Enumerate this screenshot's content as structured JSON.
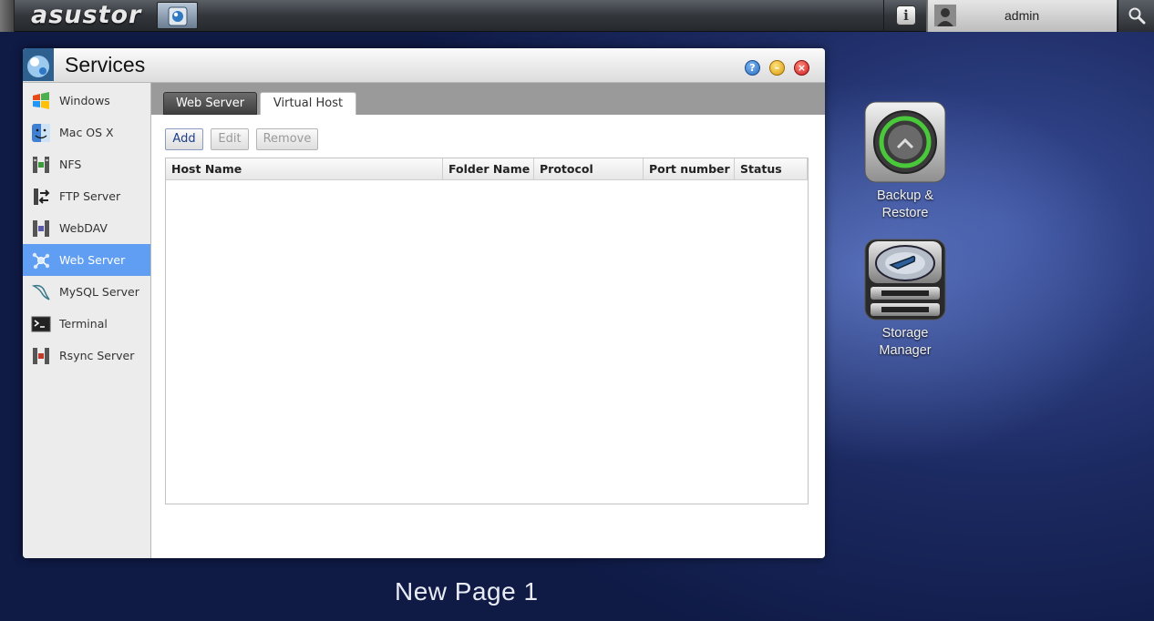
{
  "topbar": {
    "brand": "asustor",
    "user_name": "admin"
  },
  "window": {
    "title": "Services",
    "controls": {
      "help": "?",
      "minimize": "–",
      "close": "×"
    }
  },
  "sidebar": {
    "items": [
      {
        "label": "Windows",
        "icon": "windows-icon"
      },
      {
        "label": "Mac OS X",
        "icon": "finder-icon"
      },
      {
        "label": "NFS",
        "icon": "nfs-icon"
      },
      {
        "label": "FTP Server",
        "icon": "ftp-icon"
      },
      {
        "label": "WebDAV",
        "icon": "webdav-icon"
      },
      {
        "label": "Web Server",
        "icon": "web-server-icon",
        "active": true
      },
      {
        "label": "MySQL Server",
        "icon": "mysql-icon"
      },
      {
        "label": "Terminal",
        "icon": "terminal-icon"
      },
      {
        "label": "Rsync Server",
        "icon": "rsync-icon"
      }
    ]
  },
  "tabs": [
    {
      "label": "Web Server"
    },
    {
      "label": "Virtual Host",
      "selected": true
    }
  ],
  "toolbar": {
    "add_label": "Add",
    "edit_label": "Edit",
    "remove_label": "Remove"
  },
  "table": {
    "columns": [
      "Host Name",
      "Folder Name",
      "Protocol",
      "Port number",
      "Status"
    ],
    "rows": []
  },
  "desktop": {
    "icons": [
      {
        "line1": "Backup &",
        "line2": "Restore",
        "icon": "backup-restore-icon"
      },
      {
        "line1": "Storage",
        "line2": "Manager",
        "icon": "storage-manager-icon"
      }
    ],
    "page_name": "New Page 1"
  },
  "colors": {
    "sidebar_active": "#5f9ef2",
    "desktop_bg": "#1c2a62"
  }
}
